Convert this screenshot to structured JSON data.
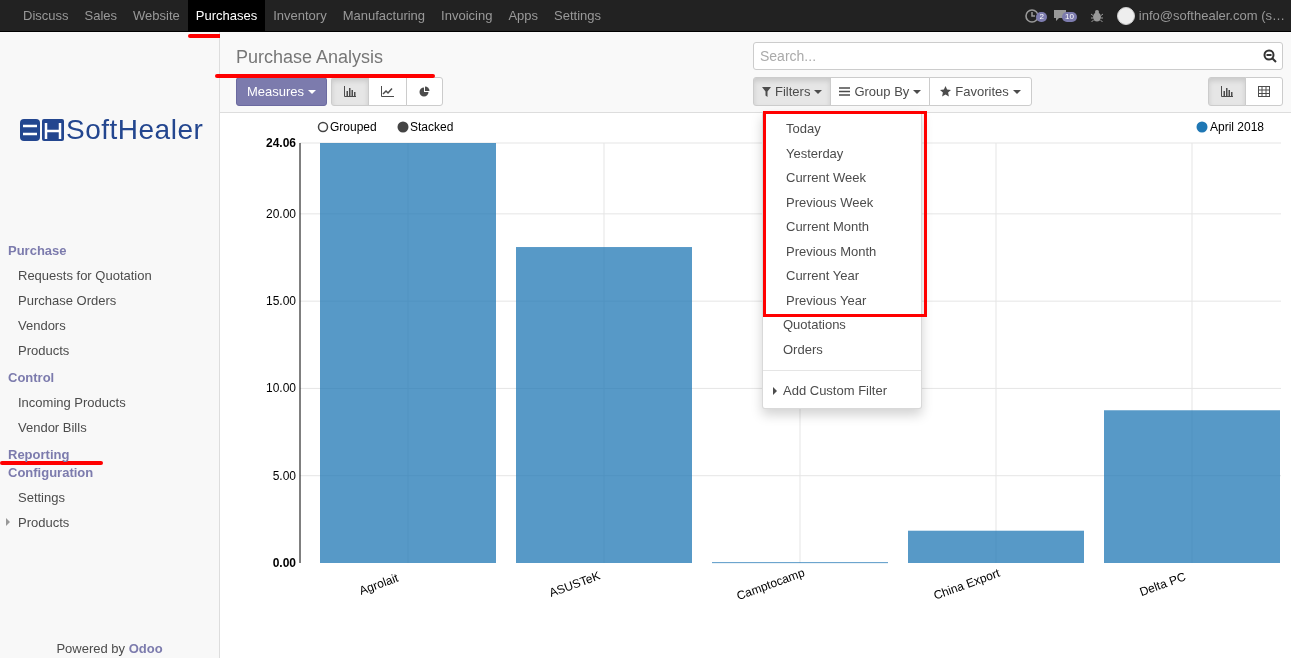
{
  "top_menu": [
    {
      "label": "Discuss",
      "selected": false,
      "underlined": false
    },
    {
      "label": "Sales",
      "selected": false,
      "underlined": false
    },
    {
      "label": "Website",
      "selected": false,
      "underlined": false
    },
    {
      "label": "Purchases",
      "selected": true,
      "underlined": true
    },
    {
      "label": "Inventory",
      "selected": false,
      "underlined": false
    },
    {
      "label": "Manufacturing",
      "selected": false,
      "underlined": false
    },
    {
      "label": "Invoicing",
      "selected": false,
      "underlined": false
    },
    {
      "label": "Apps",
      "selected": false,
      "underlined": false
    },
    {
      "label": "Settings",
      "selected": false,
      "underlined": false
    }
  ],
  "systray": {
    "activities_count": "2",
    "messages_count": "10",
    "user": "info@softhealer.com (s…"
  },
  "logo": {
    "text": "SoftHealer"
  },
  "sidebar": {
    "sections": [
      {
        "title": "Purchase",
        "items": [
          {
            "label": "Requests for Quotation",
            "expandable": false
          },
          {
            "label": "Purchase Orders",
            "expandable": false
          },
          {
            "label": "Vendors",
            "expandable": false
          },
          {
            "label": "Products",
            "expandable": false
          }
        ]
      },
      {
        "title": "Control",
        "items": [
          {
            "label": "Incoming Products",
            "expandable": false
          },
          {
            "label": "Vendor Bills",
            "expandable": false
          }
        ]
      },
      {
        "title": "Reporting",
        "underlined": true
      },
      {
        "title": "Configuration",
        "items": [
          {
            "label": "Settings",
            "expandable": false
          },
          {
            "label": "Products",
            "expandable": true
          }
        ]
      }
    ],
    "footer": "Powered by **Odoo**"
  },
  "control_panel": {
    "title": "Purchase Analysis",
    "title_underlined": true,
    "measures": "Measures",
    "chart_types": [
      {
        "kind": "bar",
        "selected": true
      },
      {
        "kind": "line",
        "selected": false
      },
      {
        "kind": "pie",
        "selected": false
      }
    ],
    "search": {
      "placeholder": "Search..."
    },
    "filters": "Filters",
    "group_by": "Group By",
    "favorites": "Favorites",
    "filters_open": true,
    "views": [
      {
        "kind": "graph",
        "selected": true
      },
      {
        "kind": "pivot",
        "selected": false
      }
    ]
  },
  "filters_menu": {
    "groups": [
      {
        "framed": true,
        "items": [
          "Today",
          "Yesterday",
          "Current Week",
          "Previous Week",
          "Current Month",
          "Previous Month",
          "Current Year",
          "Previous Year"
        ]
      },
      {
        "items": [
          "Quotations",
          "Orders"
        ]
      }
    ],
    "custom_filter": "Add Custom Filter"
  },
  "graph": {
    "modes": [
      {
        "label": "Grouped",
        "selected": false
      },
      {
        "label": "Stacked",
        "selected": true
      }
    ],
    "chart_data": {
      "type": "bar",
      "categories": [
        "Agrolait",
        "ASUSTeK",
        "Camptocamp",
        "China Export",
        "Delta PC"
      ],
      "series": [
        {
          "name": "April 2018",
          "color": "#1f77b4",
          "values": [
            24.06,
            18.1,
            0.05,
            1.85,
            8.75
          ]
        }
      ],
      "ylim": [
        0,
        24.06
      ],
      "grid": true,
      "yticks": [
        {
          "value": 0,
          "label": "0.00"
        },
        {
          "value": 5,
          "label": "5.00"
        },
        {
          "value": 10,
          "label": "10.00"
        },
        {
          "value": 15,
          "label": "15.00"
        },
        {
          "value": 20,
          "label": "20.00"
        },
        {
          "value": 24.06,
          "label": "24.06"
        }
      ]
    }
  }
}
